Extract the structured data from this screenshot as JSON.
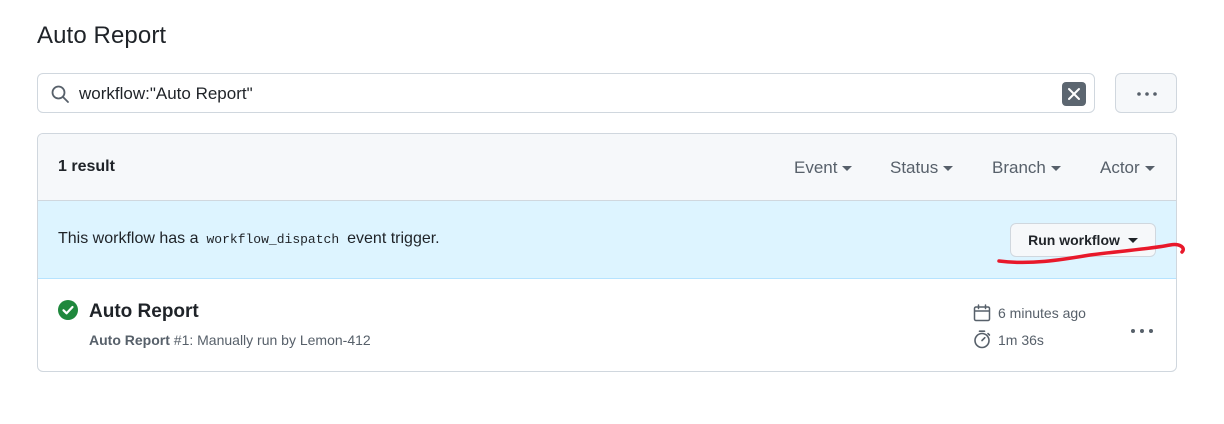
{
  "page": {
    "title": "Auto Report"
  },
  "search": {
    "value": "workflow:\"Auto Report\"",
    "icon": "search-icon",
    "clear_icon": "x-icon"
  },
  "toolbar": {
    "more_icon": "kebab-horizontal-icon"
  },
  "results": {
    "count_label": "1 result",
    "filters": [
      {
        "label": "Event"
      },
      {
        "label": "Status"
      },
      {
        "label": "Branch"
      },
      {
        "label": "Actor"
      }
    ]
  },
  "banner": {
    "text_before": "This workflow has a",
    "code": "workflow_dispatch",
    "text_after": "event trigger.",
    "button_label": "Run workflow"
  },
  "run": {
    "title": "Auto Report",
    "status": "success",
    "workflow_name": "Auto Report",
    "description": " #1: Manually run by Lemon-412",
    "time_ago": "6 minutes ago",
    "duration": "1m 36s"
  },
  "colors": {
    "success": "#1f883d",
    "banner_bg": "#ddf4ff",
    "annotation": "#e8182a"
  }
}
